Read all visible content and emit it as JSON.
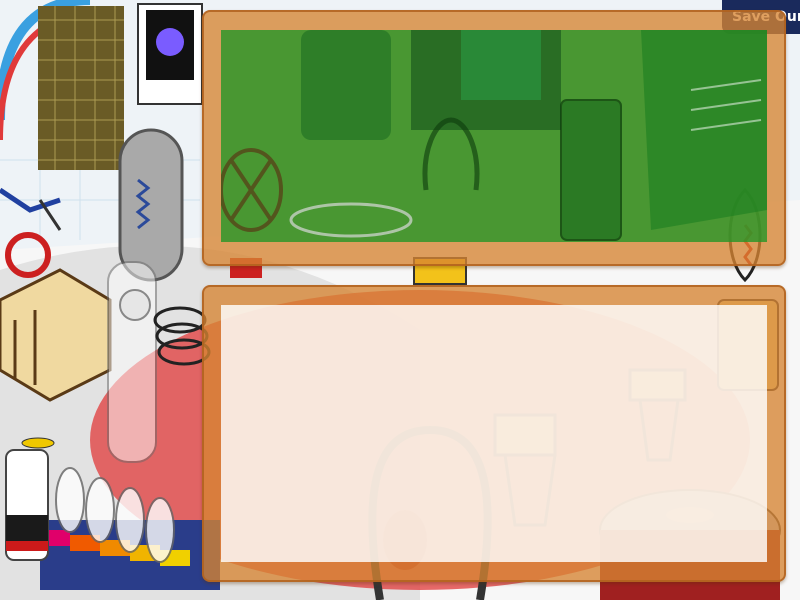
{
  "sign": {
    "text": "Save Our"
  },
  "panels": {
    "top": {
      "fill": "#249628"
    },
    "bottom": {
      "fill": "#ffffff"
    }
  },
  "colors": {
    "wood": "#d68432",
    "floor_red": "#e03a3a",
    "wall_blue": "#1a2a5c",
    "pipe_blue": "#3aa0e0"
  },
  "icons": [
    "bicycle-icon",
    "gear-drum-icon",
    "capsule-icon",
    "tube-icon",
    "spring-icon"
  ]
}
